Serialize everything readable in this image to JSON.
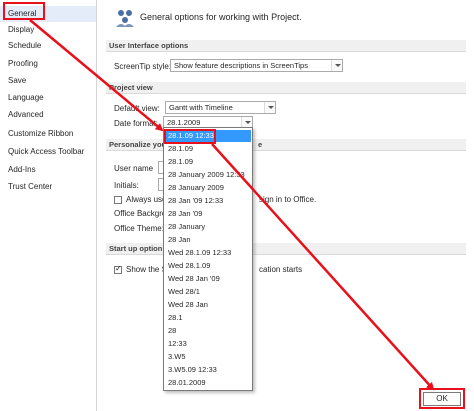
{
  "sidebar": {
    "items": [
      {
        "label": "General"
      },
      {
        "label": "Display"
      },
      {
        "label": "Schedule"
      },
      {
        "label": "Proofing"
      },
      {
        "label": "Save"
      },
      {
        "label": "Language"
      },
      {
        "label": "Advanced"
      },
      {
        "label": "Customize Ribbon"
      },
      {
        "label": "Quick Access Toolbar"
      },
      {
        "label": "Add-Ins"
      },
      {
        "label": "Trust Center"
      }
    ],
    "selected_index": 0
  },
  "header": {
    "title": "General options for working with Project.",
    "icon": "general-options-icon"
  },
  "ui_options": {
    "section_title": "User Interface options",
    "screentip_label": "ScreenTip style:",
    "screentip_value": "Show feature descriptions in ScreenTips"
  },
  "project_view": {
    "section_title": "Project view",
    "default_view_label": "Default view:",
    "default_view_value": "Gantt with Timeline",
    "date_format_label": "Date format:",
    "date_format_value": "28.1.2009"
  },
  "personalize": {
    "section_title_visible": "Personalize you",
    "section_title_tail": "e",
    "user_name_label": "User name",
    "initials_label": "Initials:",
    "always_use_label": "Always use",
    "always_use_tail": "sign in to Office.",
    "background_label": "Office Backgro",
    "theme_label": "Office Theme:"
  },
  "startup": {
    "section_title_visible": "Start up option",
    "show_label": "Show the S",
    "show_tail": "cation starts"
  },
  "date_dropdown": {
    "options": [
      "28.1.09 12:33",
      "28.1.09",
      "28.1.09",
      "28 January 2009 12:33",
      "28 January 2009",
      "28 Jan '09 12:33",
      "28 Jan '09",
      "28 January",
      "28 Jan",
      "Wed 28.1.09 12:33",
      "Wed 28.1.09",
      "Wed 28 Jan '09",
      "Wed 28/1",
      "Wed 28 Jan",
      "28.1",
      "28",
      "12:33",
      "3.W5",
      "3.W5.09 12:33",
      "28.01.2009"
    ],
    "selected_index": 0
  },
  "footer": {
    "ok_label": "OK"
  },
  "colors": {
    "highlight_red": "#e8101a",
    "selection_blue": "#3399ff",
    "sidebar_selected": "#e3ecf8"
  }
}
